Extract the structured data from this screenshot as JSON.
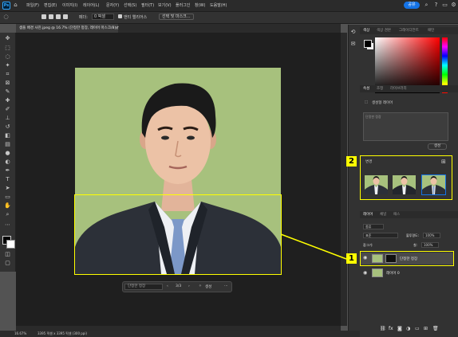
{
  "app": {
    "logo": "Ps"
  },
  "menu": [
    "파일(F)",
    "편집(E)",
    "이미지(I)",
    "레이어(L)",
    "문자(Y)",
    "선택(S)",
    "필터(T)",
    "보기(V)",
    "플러그인",
    "창(W)",
    "도움말(H)"
  ],
  "topbar": {
    "share_label": "공유"
  },
  "options": {
    "feather_label": "페더:",
    "feather_value": "0 픽셀",
    "antialias_label": "앤티 앨리어스",
    "select_mask_label": "선택 및 마스크..."
  },
  "document_tab": {
    "title": "샘플 배경 사진.jpeg @ 16.7% (단정한 정장, 레이어 마스크/8) *"
  },
  "contextual_bar": {
    "prompt_value": "단정한 정장",
    "page_indicator": "3/3",
    "generate_label": "생성"
  },
  "status": {
    "zoom": "16.67%",
    "doc_info": "3395 픽셀 x 3395 픽셀 (300 ppi)"
  },
  "color_panel": {
    "tabs": [
      "색상",
      "색상 견본",
      "그레이디언트",
      "패턴"
    ]
  },
  "properties_panel": {
    "tabs": [
      "속성",
      "조정",
      "라이브러리"
    ],
    "layer_type": "생성형 레이어",
    "prompt_value": "단정한 정장",
    "generate_label": "생성"
  },
  "variations_panel": {
    "title": "변경"
  },
  "layers_panel": {
    "tabs": [
      "레이어",
      "채널",
      "패스"
    ],
    "search_kind": "종류",
    "blend_mode": "표준",
    "opacity_label": "불투명도:",
    "opacity_value": "100%",
    "lock_label": "잠그기:",
    "fill_label": "칠:",
    "fill_value": "100%",
    "layers": [
      {
        "name": "단정한 정장",
        "selected": true
      },
      {
        "name": "레이어 0",
        "selected": false
      }
    ]
  },
  "annotations": [
    {
      "number": "1",
      "target": "generative-layer-row"
    },
    {
      "number": "2",
      "target": "variations-panel"
    }
  ],
  "colors": {
    "highlight": "#ffff00",
    "accent": "#1473e6",
    "photo_bg": "#a7c17d"
  }
}
